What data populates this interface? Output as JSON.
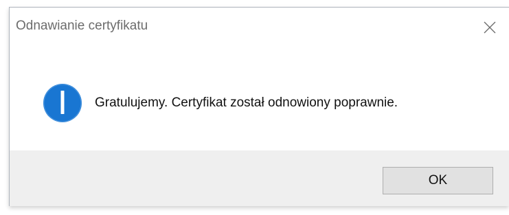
{
  "dialog": {
    "title": "Odnawianie certyfikatu",
    "close_icon": "close-icon",
    "message_icon": "info-icon",
    "message": "Gratulujemy. Certyfikat został odnowiony poprawnie.",
    "ok_label": "OK"
  },
  "colors": {
    "info_blue": "#1976d2",
    "footer_bg": "#efefef",
    "button_bg": "#e1e1e1"
  }
}
